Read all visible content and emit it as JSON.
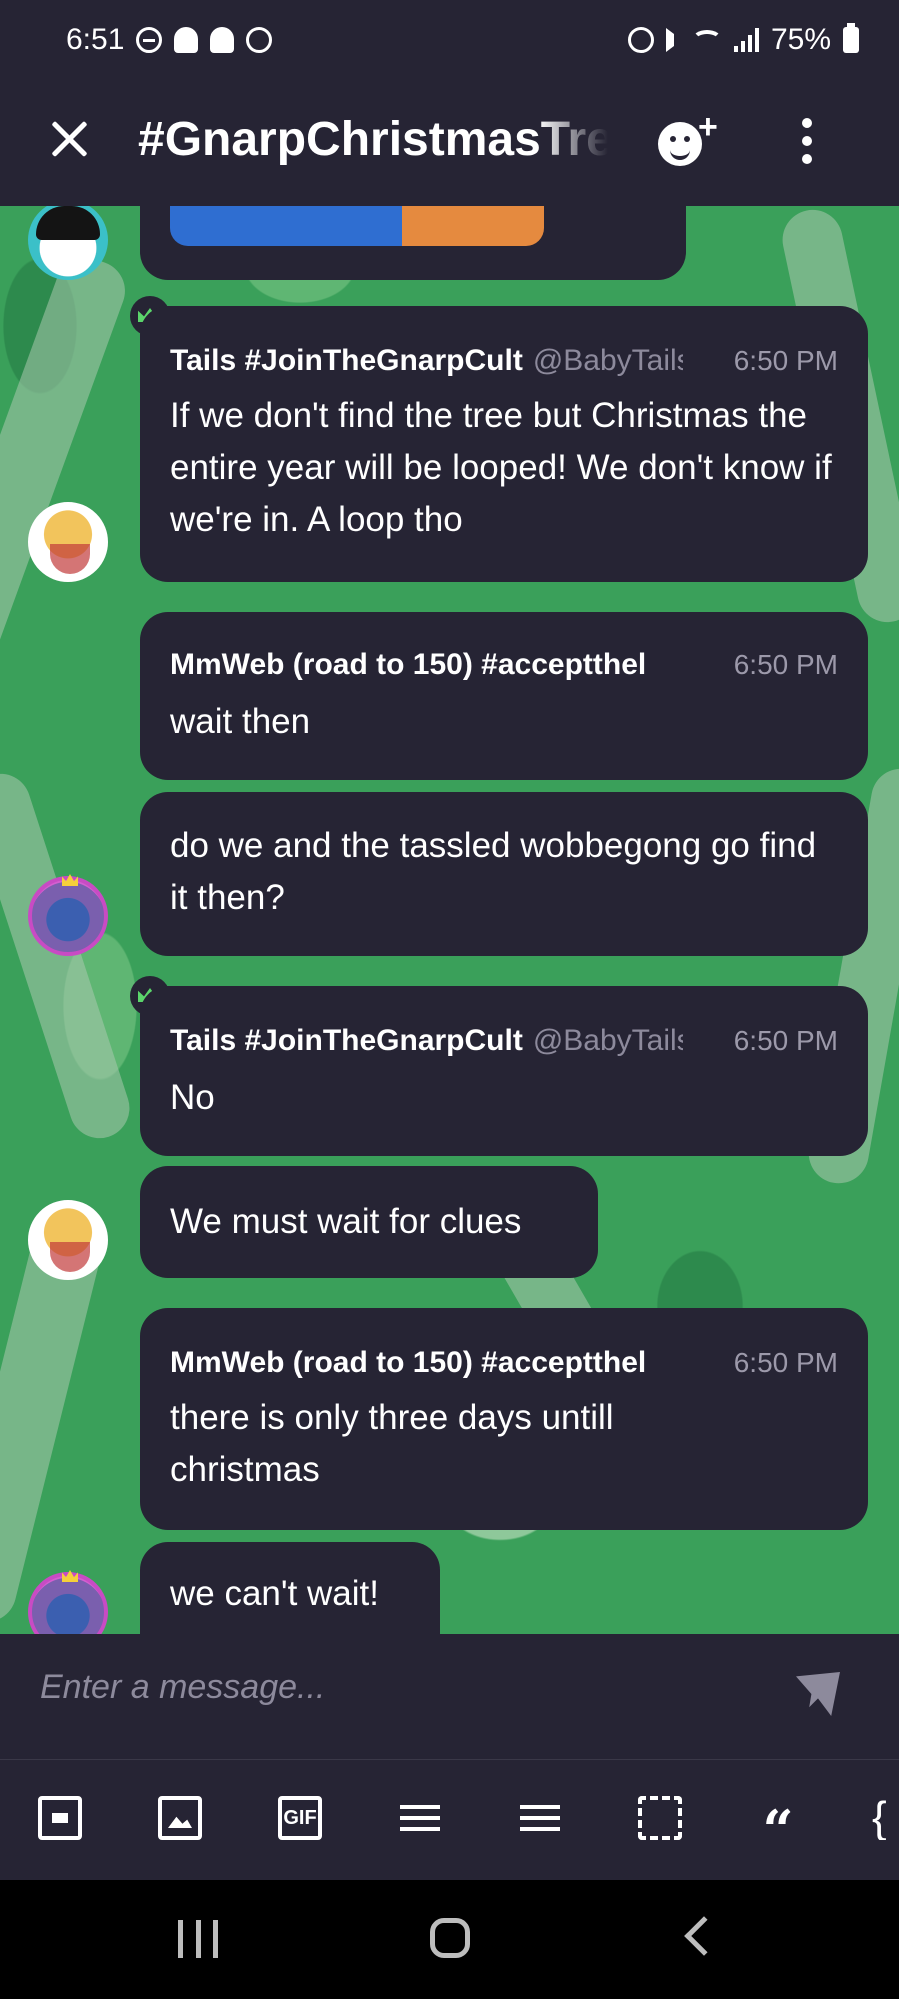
{
  "status_bar": {
    "time": "6:51",
    "battery": "75%",
    "left_icons": [
      "do-not-disturb-icon",
      "snapchat-icon",
      "snapchat-icon",
      "alarm-icon"
    ],
    "right_icons": [
      "alarm-icon",
      "mute-icon",
      "wifi-icon",
      "signal-icon",
      "battery-icon"
    ]
  },
  "header": {
    "title": "#GnarpChristmasTree",
    "close_icon": "close-icon",
    "add_user_icon": "add-user-icon",
    "more_icon": "more-vertical-icon"
  },
  "messages": [
    {
      "author": "Tails #JoinTheGnarpCult",
      "handle": "@BabyTails",
      "time": "6:50 PM",
      "text": "If we don't find the tree but Christmas the entire year will be looped! We don't know if we're in. A loop tho"
    },
    {
      "author": "MmWeb (road to 150) #acceptthel",
      "time": "6:50 PM",
      "text": "wait then"
    },
    {
      "text": "do we and the tassled wobbegong go find it then?"
    },
    {
      "author": "Tails #JoinTheGnarpCult",
      "handle": "@BabyTails",
      "time": "6:50 PM",
      "text": "No"
    },
    {
      "text": "We must wait for clues"
    },
    {
      "author": "MmWeb (road to 150) #acceptthel",
      "time": "6:50 PM",
      "text": "there is only three days untill christmas"
    },
    {
      "text": "we can't wait!"
    }
  ],
  "composer": {
    "placeholder": "Enter a message..."
  },
  "toolbar": {
    "gif_label": "GIF",
    "quote_label": "“",
    "code_label": "{"
  },
  "colors": {
    "bubble": "#262434",
    "chat_background": "#3aa05a",
    "crown": "#5bd56b"
  }
}
